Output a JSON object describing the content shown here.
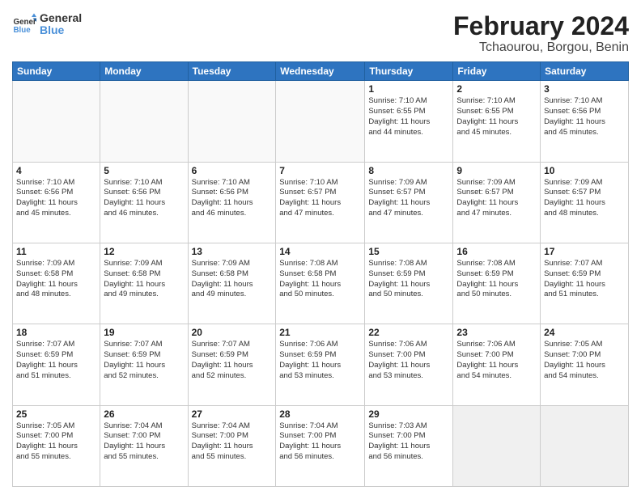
{
  "logo": {
    "line1": "General",
    "line2": "Blue"
  },
  "title": "February 2024",
  "subtitle": "Tchaourou, Borgou, Benin",
  "days_of_week": [
    "Sunday",
    "Monday",
    "Tuesday",
    "Wednesday",
    "Thursday",
    "Friday",
    "Saturday"
  ],
  "weeks": [
    [
      {
        "day": "",
        "info": ""
      },
      {
        "day": "",
        "info": ""
      },
      {
        "day": "",
        "info": ""
      },
      {
        "day": "",
        "info": ""
      },
      {
        "day": "1",
        "info": "Sunrise: 7:10 AM\nSunset: 6:55 PM\nDaylight: 11 hours\nand 44 minutes."
      },
      {
        "day": "2",
        "info": "Sunrise: 7:10 AM\nSunset: 6:55 PM\nDaylight: 11 hours\nand 45 minutes."
      },
      {
        "day": "3",
        "info": "Sunrise: 7:10 AM\nSunset: 6:56 PM\nDaylight: 11 hours\nand 45 minutes."
      }
    ],
    [
      {
        "day": "4",
        "info": "Sunrise: 7:10 AM\nSunset: 6:56 PM\nDaylight: 11 hours\nand 45 minutes."
      },
      {
        "day": "5",
        "info": "Sunrise: 7:10 AM\nSunset: 6:56 PM\nDaylight: 11 hours\nand 46 minutes."
      },
      {
        "day": "6",
        "info": "Sunrise: 7:10 AM\nSunset: 6:56 PM\nDaylight: 11 hours\nand 46 minutes."
      },
      {
        "day": "7",
        "info": "Sunrise: 7:10 AM\nSunset: 6:57 PM\nDaylight: 11 hours\nand 47 minutes."
      },
      {
        "day": "8",
        "info": "Sunrise: 7:09 AM\nSunset: 6:57 PM\nDaylight: 11 hours\nand 47 minutes."
      },
      {
        "day": "9",
        "info": "Sunrise: 7:09 AM\nSunset: 6:57 PM\nDaylight: 11 hours\nand 47 minutes."
      },
      {
        "day": "10",
        "info": "Sunrise: 7:09 AM\nSunset: 6:57 PM\nDaylight: 11 hours\nand 48 minutes."
      }
    ],
    [
      {
        "day": "11",
        "info": "Sunrise: 7:09 AM\nSunset: 6:58 PM\nDaylight: 11 hours\nand 48 minutes."
      },
      {
        "day": "12",
        "info": "Sunrise: 7:09 AM\nSunset: 6:58 PM\nDaylight: 11 hours\nand 49 minutes."
      },
      {
        "day": "13",
        "info": "Sunrise: 7:09 AM\nSunset: 6:58 PM\nDaylight: 11 hours\nand 49 minutes."
      },
      {
        "day": "14",
        "info": "Sunrise: 7:08 AM\nSunset: 6:58 PM\nDaylight: 11 hours\nand 50 minutes."
      },
      {
        "day": "15",
        "info": "Sunrise: 7:08 AM\nSunset: 6:59 PM\nDaylight: 11 hours\nand 50 minutes."
      },
      {
        "day": "16",
        "info": "Sunrise: 7:08 AM\nSunset: 6:59 PM\nDaylight: 11 hours\nand 50 minutes."
      },
      {
        "day": "17",
        "info": "Sunrise: 7:07 AM\nSunset: 6:59 PM\nDaylight: 11 hours\nand 51 minutes."
      }
    ],
    [
      {
        "day": "18",
        "info": "Sunrise: 7:07 AM\nSunset: 6:59 PM\nDaylight: 11 hours\nand 51 minutes."
      },
      {
        "day": "19",
        "info": "Sunrise: 7:07 AM\nSunset: 6:59 PM\nDaylight: 11 hours\nand 52 minutes."
      },
      {
        "day": "20",
        "info": "Sunrise: 7:07 AM\nSunset: 6:59 PM\nDaylight: 11 hours\nand 52 minutes."
      },
      {
        "day": "21",
        "info": "Sunrise: 7:06 AM\nSunset: 6:59 PM\nDaylight: 11 hours\nand 53 minutes."
      },
      {
        "day": "22",
        "info": "Sunrise: 7:06 AM\nSunset: 7:00 PM\nDaylight: 11 hours\nand 53 minutes."
      },
      {
        "day": "23",
        "info": "Sunrise: 7:06 AM\nSunset: 7:00 PM\nDaylight: 11 hours\nand 54 minutes."
      },
      {
        "day": "24",
        "info": "Sunrise: 7:05 AM\nSunset: 7:00 PM\nDaylight: 11 hours\nand 54 minutes."
      }
    ],
    [
      {
        "day": "25",
        "info": "Sunrise: 7:05 AM\nSunset: 7:00 PM\nDaylight: 11 hours\nand 55 minutes."
      },
      {
        "day": "26",
        "info": "Sunrise: 7:04 AM\nSunset: 7:00 PM\nDaylight: 11 hours\nand 55 minutes."
      },
      {
        "day": "27",
        "info": "Sunrise: 7:04 AM\nSunset: 7:00 PM\nDaylight: 11 hours\nand 55 minutes."
      },
      {
        "day": "28",
        "info": "Sunrise: 7:04 AM\nSunset: 7:00 PM\nDaylight: 11 hours\nand 56 minutes."
      },
      {
        "day": "29",
        "info": "Sunrise: 7:03 AM\nSunset: 7:00 PM\nDaylight: 11 hours\nand 56 minutes."
      },
      {
        "day": "",
        "info": ""
      },
      {
        "day": "",
        "info": ""
      }
    ]
  ]
}
